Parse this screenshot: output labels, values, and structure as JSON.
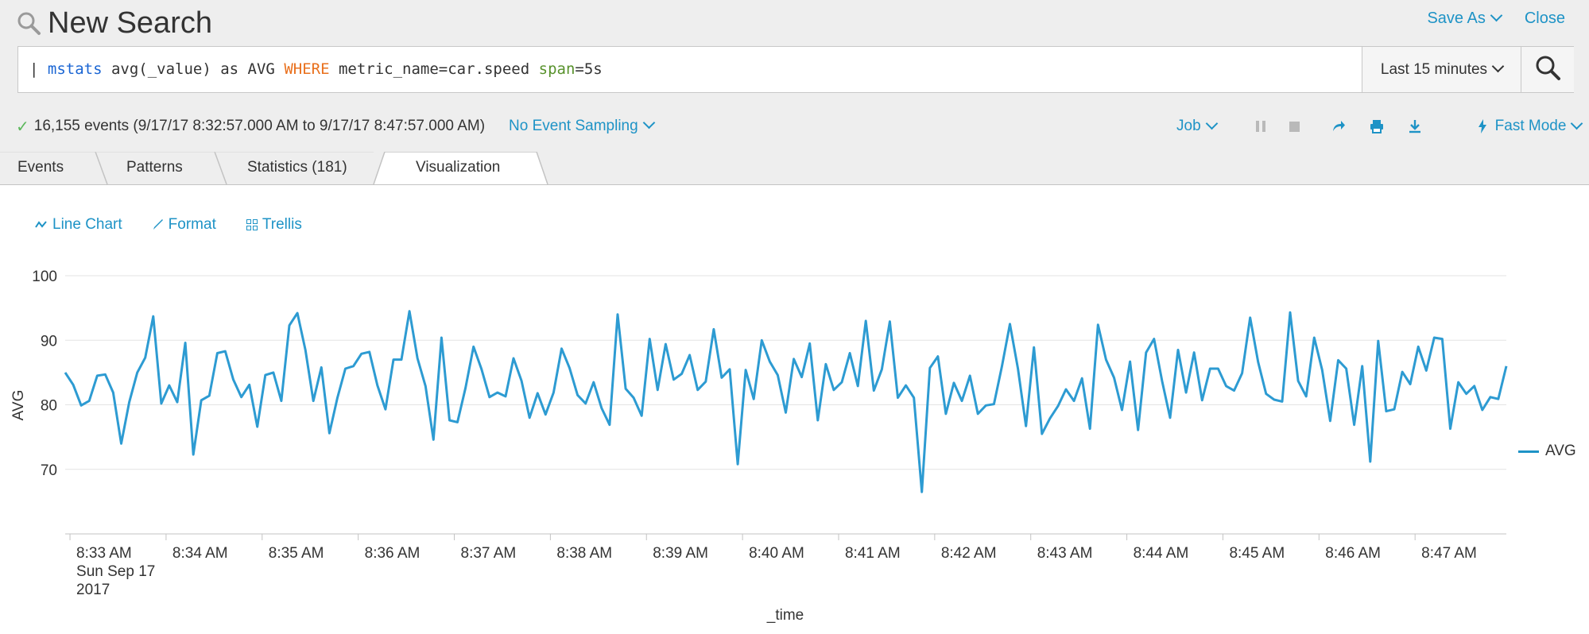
{
  "header": {
    "title": "New Search",
    "save_as": "Save As",
    "close": "Close"
  },
  "search": {
    "query_parts": {
      "pipe": "| ",
      "command": "mstats",
      "middle": " avg(_value) as AVG ",
      "keyword": "WHERE",
      "metric": " metric_name=car.speed ",
      "arg": "span",
      "arg_value": "=5s"
    },
    "time_range": "Last 15 minutes"
  },
  "status": {
    "events": "16,155 events (9/17/17 8:32:57.000 AM to 9/17/17 8:47:57.000 AM)",
    "sampling": "No Event Sampling",
    "job": "Job",
    "mode": "Fast Mode"
  },
  "tabs": [
    "Events",
    "Patterns",
    "Statistics (181)",
    "Visualization"
  ],
  "viz_toolbar": {
    "chart_type": "Line Chart",
    "format": "Format",
    "trellis": "Trellis"
  },
  "colors": {
    "accent": "#1e93c6",
    "series": "#2d9bd2",
    "header_bg": "#eeeeee"
  },
  "chart_data": {
    "type": "line",
    "xlabel": "_time",
    "ylabel": "AVG",
    "ylim": [
      60,
      100
    ],
    "y_ticks": [
      70,
      80,
      90,
      100
    ],
    "x_ticks": [
      "8:33 AM",
      "8:34 AM",
      "8:35 AM",
      "8:36 AM",
      "8:37 AM",
      "8:38 AM",
      "8:39 AM",
      "8:40 AM",
      "8:41 AM",
      "8:42 AM",
      "8:43 AM",
      "8:44 AM",
      "8:45 AM",
      "8:46 AM",
      "8:47 AM"
    ],
    "x_tick_sub": [
      "Sun Sep 17",
      "2017"
    ],
    "x_start": "8:32:57 AM",
    "x_step": "5s",
    "grid": true,
    "legend": "right",
    "series": [
      {
        "name": "AVG",
        "values": [
          85.0,
          83.1,
          79.9,
          80.6,
          84.5,
          84.7,
          81.9,
          74.0,
          80.4,
          85.0,
          87.3,
          93.7,
          80.2,
          83.0,
          80.4,
          89.6,
          72.3,
          80.7,
          81.4,
          88.0,
          88.3,
          83.9,
          81.2,
          83.1,
          76.6,
          84.6,
          85.0,
          80.6,
          92.3,
          94.2,
          88.5,
          80.6,
          85.8,
          75.6,
          81.1,
          85.6,
          86.0,
          87.9,
          88.2,
          83.0,
          79.3,
          87.0,
          87.0,
          94.5,
          87.2,
          82.9,
          74.6,
          90.4,
          77.6,
          77.3,
          82.6,
          89.0,
          85.5,
          81.2,
          81.9,
          81.3,
          87.2,
          83.7,
          78.0,
          81.8,
          78.5,
          81.9,
          88.7,
          85.7,
          81.5,
          80.2,
          83.5,
          79.5,
          76.9,
          94.0,
          82.5,
          81.1,
          78.3,
          90.2,
          82.3,
          89.4,
          83.9,
          84.8,
          87.7,
          82.3,
          83.6,
          91.7,
          84.2,
          85.5,
          70.8,
          85.4,
          80.9,
          90.0,
          86.7,
          84.6,
          78.8,
          87.1,
          84.3,
          89.5,
          77.6,
          86.3,
          82.3,
          83.5,
          88.0,
          82.9,
          93.0,
          82.2,
          85.5,
          92.9,
          81.1,
          83.0,
          81.1,
          66.5,
          85.7,
          87.5,
          78.6,
          83.4,
          80.6,
          84.5,
          78.6,
          79.9,
          80.1,
          86.0,
          92.5,
          85.6,
          76.7,
          88.9,
          75.5,
          77.9,
          79.8,
          82.4,
          80.6,
          84.1,
          76.3,
          92.4,
          87.0,
          84.2,
          79.2,
          86.7,
          76.1,
          88.1,
          90.2,
          83.7,
          78.0,
          88.5,
          81.9,
          88.1,
          80.7,
          85.6,
          85.6,
          82.9,
          82.2,
          84.9,
          93.5,
          86.6,
          81.7,
          80.8,
          80.5,
          94.3,
          83.7,
          81.3,
          90.4,
          85.4,
          77.5,
          86.9,
          85.6,
          76.9,
          86.0,
          71.2,
          89.9,
          79.0,
          79.3,
          85.1,
          83.2,
          89.0,
          85.3,
          90.4,
          90.2,
          76.3,
          83.5,
          81.7,
          82.9,
          79.2,
          81.2,
          80.9,
          86.0
        ]
      }
    ]
  }
}
